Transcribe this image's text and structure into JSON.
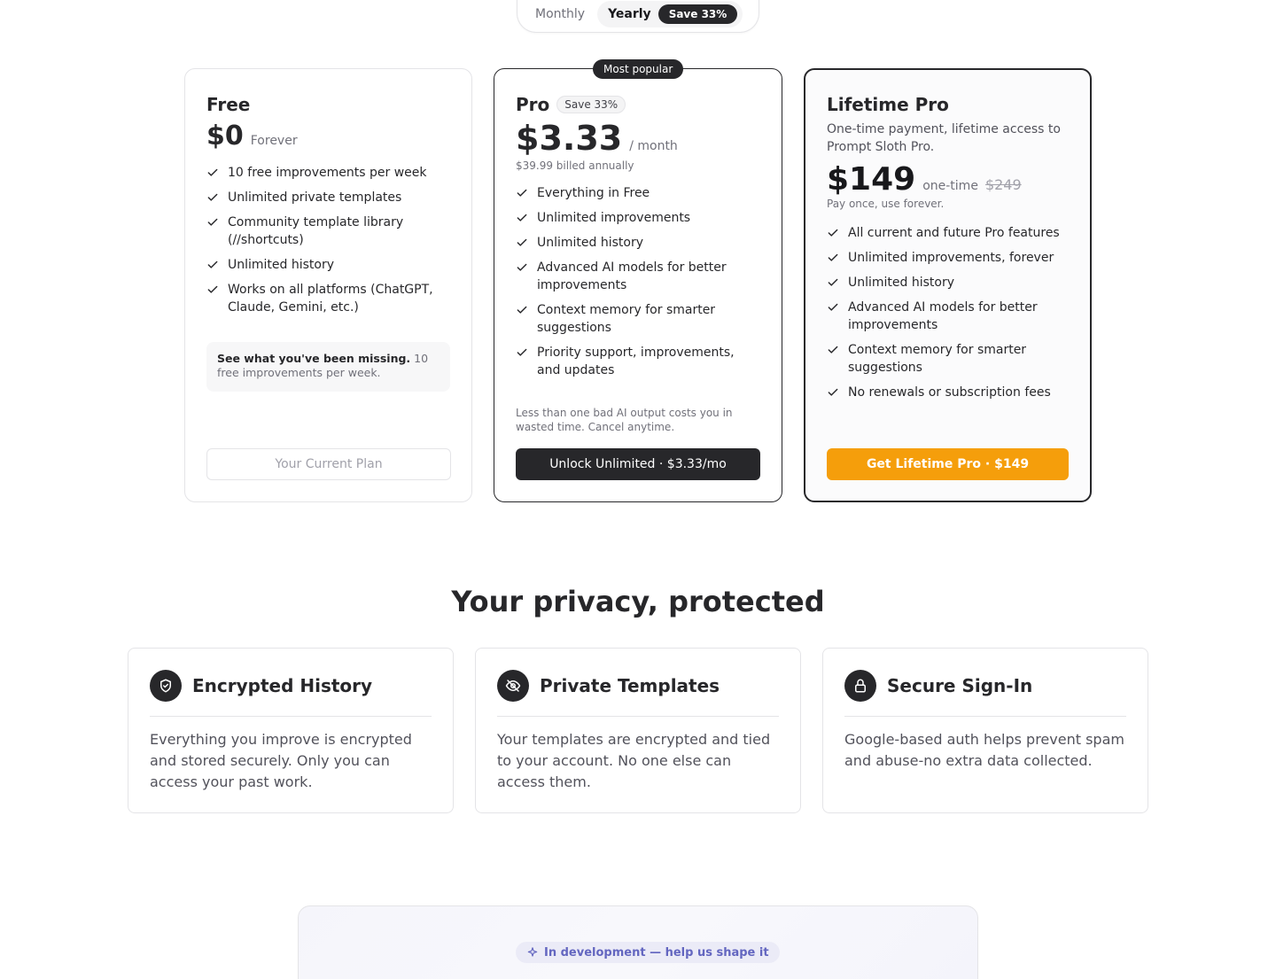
{
  "billing_toggle": {
    "monthly_label": "Monthly",
    "yearly_label": "Yearly",
    "save_badge": "Save 33%",
    "selected": "Yearly"
  },
  "plans": {
    "free": {
      "name": "Free",
      "price": "$0",
      "price_note": "Forever",
      "features": [
        "10 free improvements per week",
        "Unlimited private templates",
        "Community template library (//shortcuts)",
        "Unlimited history",
        "Works on all platforms (ChatGPT, Claude, Gemini, etc.)"
      ],
      "missing_bold": "See what you've been missing.",
      "missing_text": "10 free improvements per week.",
      "button": "Your Current Plan"
    },
    "pro": {
      "badge": "Most popular",
      "name": "Pro",
      "save_chip": "Save 33%",
      "price": "$3.33",
      "price_unit": "/ month",
      "billed_note": "$39.99 billed annually",
      "features": [
        "Everything in Free",
        "Unlimited improvements",
        "Unlimited history",
        "Advanced AI models for better improvements",
        "Context memory for smarter suggestions",
        "Priority support, improvements, and updates"
      ],
      "footnote": "Less than one bad AI output costs you in wasted time. Cancel anytime.",
      "button": "Unlock Unlimited · $3.33/mo"
    },
    "lifetime": {
      "name": "Lifetime Pro",
      "description": "One-time payment, lifetime access to Prompt Sloth Pro.",
      "price": "$149",
      "price_note": "one-time",
      "old_price": "$249",
      "pay_note": "Pay once, use forever.",
      "features": [
        "All current and future Pro features",
        "Unlimited improvements, forever",
        "Unlimited history",
        "Advanced AI models for better improvements",
        "Context memory for smarter suggestions",
        "No renewals or subscription fees"
      ],
      "button": "Get Lifetime Pro · $149"
    }
  },
  "privacy": {
    "title": "Your privacy, protected",
    "cards": [
      {
        "icon": "shield-check-icon",
        "title": "Encrypted History",
        "body": "Everything you improve is encrypted and stored securely. Only you can access your past work."
      },
      {
        "icon": "eye-off-icon",
        "title": "Private Templates",
        "body": "Your templates are encrypted and tied to your account. No one else can access them."
      },
      {
        "icon": "lock-icon",
        "title": "Secure Sign-In",
        "body": "Google-based auth helps prevent spam and abuse-no extra data collected."
      }
    ]
  },
  "dev_section": {
    "pill": "In development — help us shape it"
  },
  "colors": {
    "dark": "#27272a",
    "accent_orange": "#f59e0b",
    "dev_purple": "#6366c0"
  }
}
